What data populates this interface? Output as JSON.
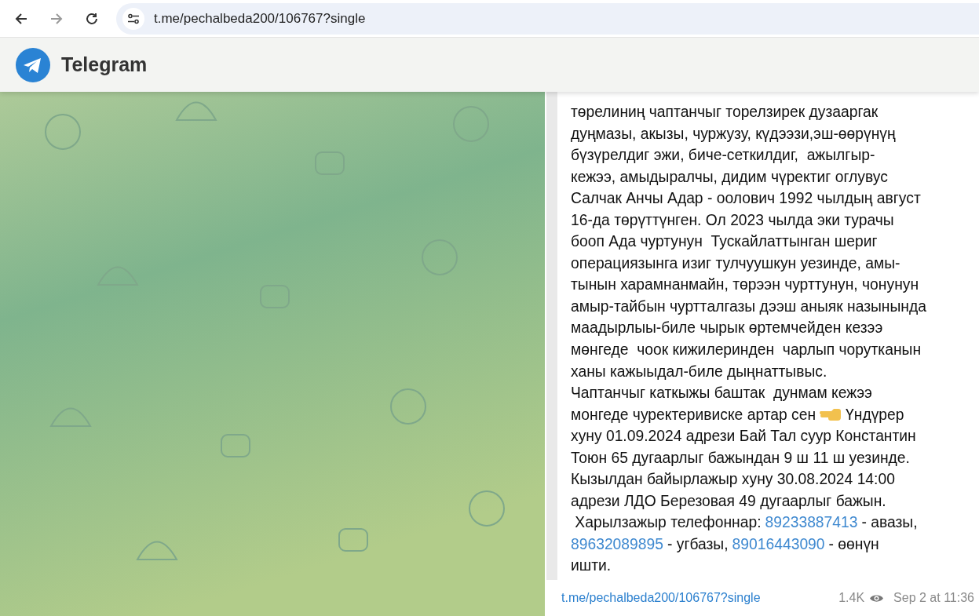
{
  "browser": {
    "url": "t.me/pechalbeda200/106767?single"
  },
  "header": {
    "title": "Telegram"
  },
  "post": {
    "lines": [
      [
        {
          "kind": "text",
          "text": "төрелиниң чаптанчыг торелзирек дузааргак"
        }
      ],
      [
        {
          "kind": "text",
          "text": "дуңмазы, акызы, чуржузу, күдээзи,эш-өөрүнүң"
        }
      ],
      [
        {
          "kind": "text",
          "text": "бүзүрелдиг эжи, биче-сеткилдиг,  ажылгыр-"
        }
      ],
      [
        {
          "kind": "text",
          "text": "кежээ, амыдыралчы, дидим чүректиг оглувус"
        }
      ],
      [
        {
          "kind": "text",
          "text": "Салчак Анчы Адар - оолович 1992 чылдың август"
        }
      ],
      [
        {
          "kind": "text",
          "text": "16-да төрүттүнген. Ол 2023 чылда эки турачы"
        }
      ],
      [
        {
          "kind": "text",
          "text": "бооп Ада чуртунун  Тускайлаттынган шериг"
        }
      ],
      [
        {
          "kind": "text",
          "text": "операциязынга изиг тулчуушкун уезинде, амы-"
        }
      ],
      [
        {
          "kind": "text",
          "text": "тынын харамнанмайн, төрээн чурттунун, чонунун"
        }
      ],
      [
        {
          "kind": "text",
          "text": "амыр-тайбын чурттaлгазы дээш аныяк назынында"
        }
      ],
      [
        {
          "kind": "text",
          "text": "маадырлыы-биле чырык өртемчейден кезээ"
        }
      ],
      [
        {
          "kind": "text",
          "text": "мөнгеде  чоок кижилеринден  чарлып чорутканын"
        }
      ],
      [
        {
          "kind": "text",
          "text": "ханы кажыыдал-биле дыңнаттывыс."
        }
      ],
      [
        {
          "kind": "text",
          "text": "Чаптанчыг каткыжы баштак  дунмам кежээ"
        }
      ],
      [
        {
          "kind": "text",
          "text": "монгеде чуректеривиске артар сен"
        },
        {
          "kind": "emoji"
        },
        {
          "kind": "text",
          "text": "Үндүрер"
        }
      ],
      [
        {
          "kind": "text",
          "text": "хуну 01.09.2024 адрези Бай Тал суур Константин"
        }
      ],
      [
        {
          "kind": "text",
          "text": "Тоюн 65 дугаарлыг бажындан 9 ш 11 ш уезинде."
        }
      ],
      [
        {
          "kind": "text",
          "text": "Кызылдан байырлажыр хуну 30.08.2024 14:00"
        }
      ],
      [
        {
          "kind": "text",
          "text": "адрези ЛДО Березовая 49 дугаарлыг бажын."
        }
      ],
      [
        {
          "kind": "text",
          "text": " Харылзажыр телефоннар:"
        },
        {
          "kind": "phone",
          "text": "89233887413"
        },
        {
          "kind": "text",
          "text": "- авазы,"
        }
      ],
      [
        {
          "kind": "phone",
          "text": "89632089895"
        },
        {
          "kind": "text",
          "text": "- угбазы,"
        },
        {
          "kind": "phone",
          "text": "89016443090"
        },
        {
          "kind": "text",
          "text": "- өөнүн"
        }
      ],
      [
        {
          "kind": "text",
          "text": "ишти."
        }
      ]
    ],
    "link": "t.me/pechalbeda200/106767?single",
    "views": "1.4K",
    "date": "Sep 2 at 11:36"
  }
}
